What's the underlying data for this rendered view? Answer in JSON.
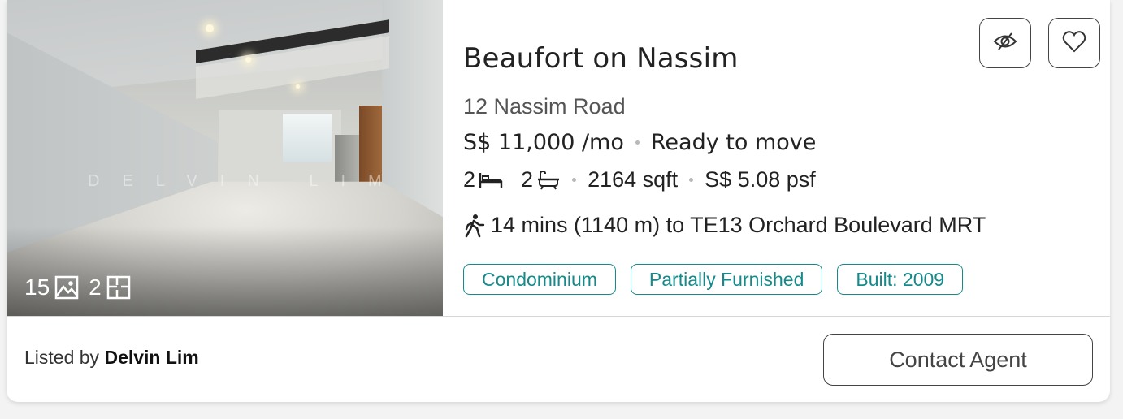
{
  "listing": {
    "photo_watermark": "DELVIN LIM",
    "media": {
      "photo_count": "15",
      "floorplan_count": "2"
    },
    "title": "Beaufort on Nassim",
    "address": "12 Nassim Road",
    "price": "S$ 11,000 /mo",
    "availability": "Ready to move",
    "bedrooms": "2",
    "bathrooms": "2",
    "area": "2164 sqft",
    "psf": "S$ 5.08 psf",
    "mrt": "14 mins (1140 m) to TE13 Orchard Boulevard MRT",
    "tags": [
      "Condominium",
      "Partially Furnished",
      "Built: 2009"
    ],
    "listed_by_prefix": "Listed by",
    "agent_name": "Delvin Lim",
    "contact_label": "Contact Agent"
  },
  "icons": {
    "photos": "image-icon",
    "floorplans": "floorplan-icon",
    "bed": "bed-icon",
    "bath": "bathtub-icon",
    "walk": "walking-icon",
    "hide": "eye-off-icon",
    "favorite": "heart-icon"
  },
  "colors": {
    "tag_accent": "#168a8a",
    "card_bg": "#ffffff"
  }
}
